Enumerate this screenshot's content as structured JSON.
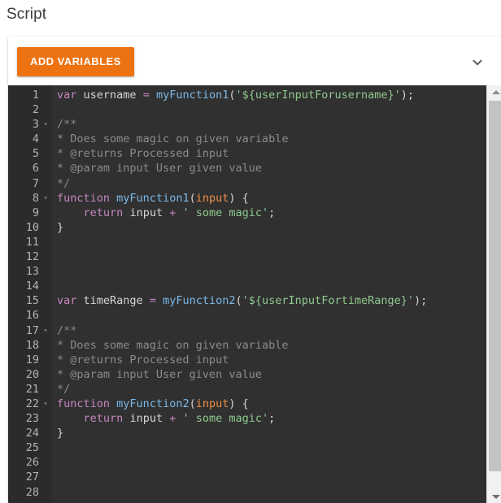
{
  "page": {
    "title": "Script"
  },
  "toolbar": {
    "add_variables_label": "ADD VARIABLES",
    "collapse_icon": "chevron-down-icon",
    "accent_color": "#ed7211"
  },
  "editor": {
    "background_color": "#303030",
    "gutter_color": "#2b2b2b",
    "line_number_color": "#b3b3b3",
    "first_visible_line": 1,
    "last_visible_line": 28,
    "fold_lines": [
      3,
      8,
      17,
      22
    ],
    "lines": [
      {
        "n": 1,
        "tokens": [
          {
            "t": "var",
            "c": "kw"
          },
          {
            "t": " ",
            "c": "pun"
          },
          {
            "t": "username",
            "c": "id"
          },
          {
            "t": " ",
            "c": "pun"
          },
          {
            "t": "=",
            "c": "kw"
          },
          {
            "t": " ",
            "c": "pun"
          },
          {
            "t": "myFunction1",
            "c": "fn"
          },
          {
            "t": "(",
            "c": "pun"
          },
          {
            "t": "'${userInputForusername}'",
            "c": "str"
          },
          {
            "t": ");",
            "c": "pun"
          }
        ]
      },
      {
        "n": 2,
        "tokens": []
      },
      {
        "n": 3,
        "tokens": [
          {
            "t": "/**",
            "c": "com"
          }
        ]
      },
      {
        "n": 4,
        "tokens": [
          {
            "t": "* Does some magic on given variable",
            "c": "com"
          }
        ]
      },
      {
        "n": 5,
        "tokens": [
          {
            "t": "* @returns Processed input",
            "c": "com"
          }
        ]
      },
      {
        "n": 6,
        "tokens": [
          {
            "t": "* @param input User given value",
            "c": "com"
          }
        ]
      },
      {
        "n": 7,
        "tokens": [
          {
            "t": "*/",
            "c": "com"
          }
        ]
      },
      {
        "n": 8,
        "tokens": [
          {
            "t": "function",
            "c": "kw"
          },
          {
            "t": " ",
            "c": "pun"
          },
          {
            "t": "myFunction1",
            "c": "fn"
          },
          {
            "t": "(",
            "c": "pun"
          },
          {
            "t": "input",
            "c": "par"
          },
          {
            "t": ") {",
            "c": "pun"
          }
        ]
      },
      {
        "n": 9,
        "tokens": [
          {
            "t": "    ",
            "c": "pun"
          },
          {
            "t": "return",
            "c": "kw"
          },
          {
            "t": " ",
            "c": "pun"
          },
          {
            "t": "input",
            "c": "id"
          },
          {
            "t": " ",
            "c": "pun"
          },
          {
            "t": "+",
            "c": "kw"
          },
          {
            "t": " ",
            "c": "pun"
          },
          {
            "t": "' some magic'",
            "c": "str"
          },
          {
            "t": ";",
            "c": "pun"
          }
        ]
      },
      {
        "n": 10,
        "tokens": [
          {
            "t": "}",
            "c": "pun"
          }
        ]
      },
      {
        "n": 11,
        "tokens": []
      },
      {
        "n": 12,
        "tokens": []
      },
      {
        "n": 13,
        "tokens": []
      },
      {
        "n": 14,
        "tokens": []
      },
      {
        "n": 15,
        "tokens": [
          {
            "t": "var",
            "c": "kw"
          },
          {
            "t": " ",
            "c": "pun"
          },
          {
            "t": "timeRange",
            "c": "id"
          },
          {
            "t": " ",
            "c": "pun"
          },
          {
            "t": "=",
            "c": "kw"
          },
          {
            "t": " ",
            "c": "pun"
          },
          {
            "t": "myFunction2",
            "c": "fn"
          },
          {
            "t": "(",
            "c": "pun"
          },
          {
            "t": "'${userInputFortimeRange}'",
            "c": "str"
          },
          {
            "t": ");",
            "c": "pun"
          }
        ]
      },
      {
        "n": 16,
        "tokens": []
      },
      {
        "n": 17,
        "tokens": [
          {
            "t": "/**",
            "c": "com"
          }
        ]
      },
      {
        "n": 18,
        "tokens": [
          {
            "t": "* Does some magic on given variable",
            "c": "com"
          }
        ]
      },
      {
        "n": 19,
        "tokens": [
          {
            "t": "* @returns Processed input",
            "c": "com"
          }
        ]
      },
      {
        "n": 20,
        "tokens": [
          {
            "t": "* @param input User given value",
            "c": "com"
          }
        ]
      },
      {
        "n": 21,
        "tokens": [
          {
            "t": "*/",
            "c": "com"
          }
        ]
      },
      {
        "n": 22,
        "tokens": [
          {
            "t": "function",
            "c": "kw"
          },
          {
            "t": " ",
            "c": "pun"
          },
          {
            "t": "myFunction2",
            "c": "fn"
          },
          {
            "t": "(",
            "c": "pun"
          },
          {
            "t": "input",
            "c": "par"
          },
          {
            "t": ") {",
            "c": "pun"
          }
        ]
      },
      {
        "n": 23,
        "tokens": [
          {
            "t": "    ",
            "c": "pun"
          },
          {
            "t": "return",
            "c": "kw"
          },
          {
            "t": " ",
            "c": "pun"
          },
          {
            "t": "input",
            "c": "id"
          },
          {
            "t": " ",
            "c": "pun"
          },
          {
            "t": "+",
            "c": "kw"
          },
          {
            "t": " ",
            "c": "pun"
          },
          {
            "t": "' some magic'",
            "c": "str"
          },
          {
            "t": ";",
            "c": "pun"
          }
        ]
      },
      {
        "n": 24,
        "tokens": [
          {
            "t": "}",
            "c": "pun"
          }
        ]
      },
      {
        "n": 25,
        "tokens": []
      },
      {
        "n": 26,
        "tokens": []
      },
      {
        "n": 27,
        "tokens": []
      },
      {
        "n": 28,
        "tokens": []
      }
    ]
  },
  "scrollbar": {
    "up_arrow": "triangle-up-icon",
    "down_arrow": "triangle-down-icon",
    "orientation": "vertical"
  }
}
